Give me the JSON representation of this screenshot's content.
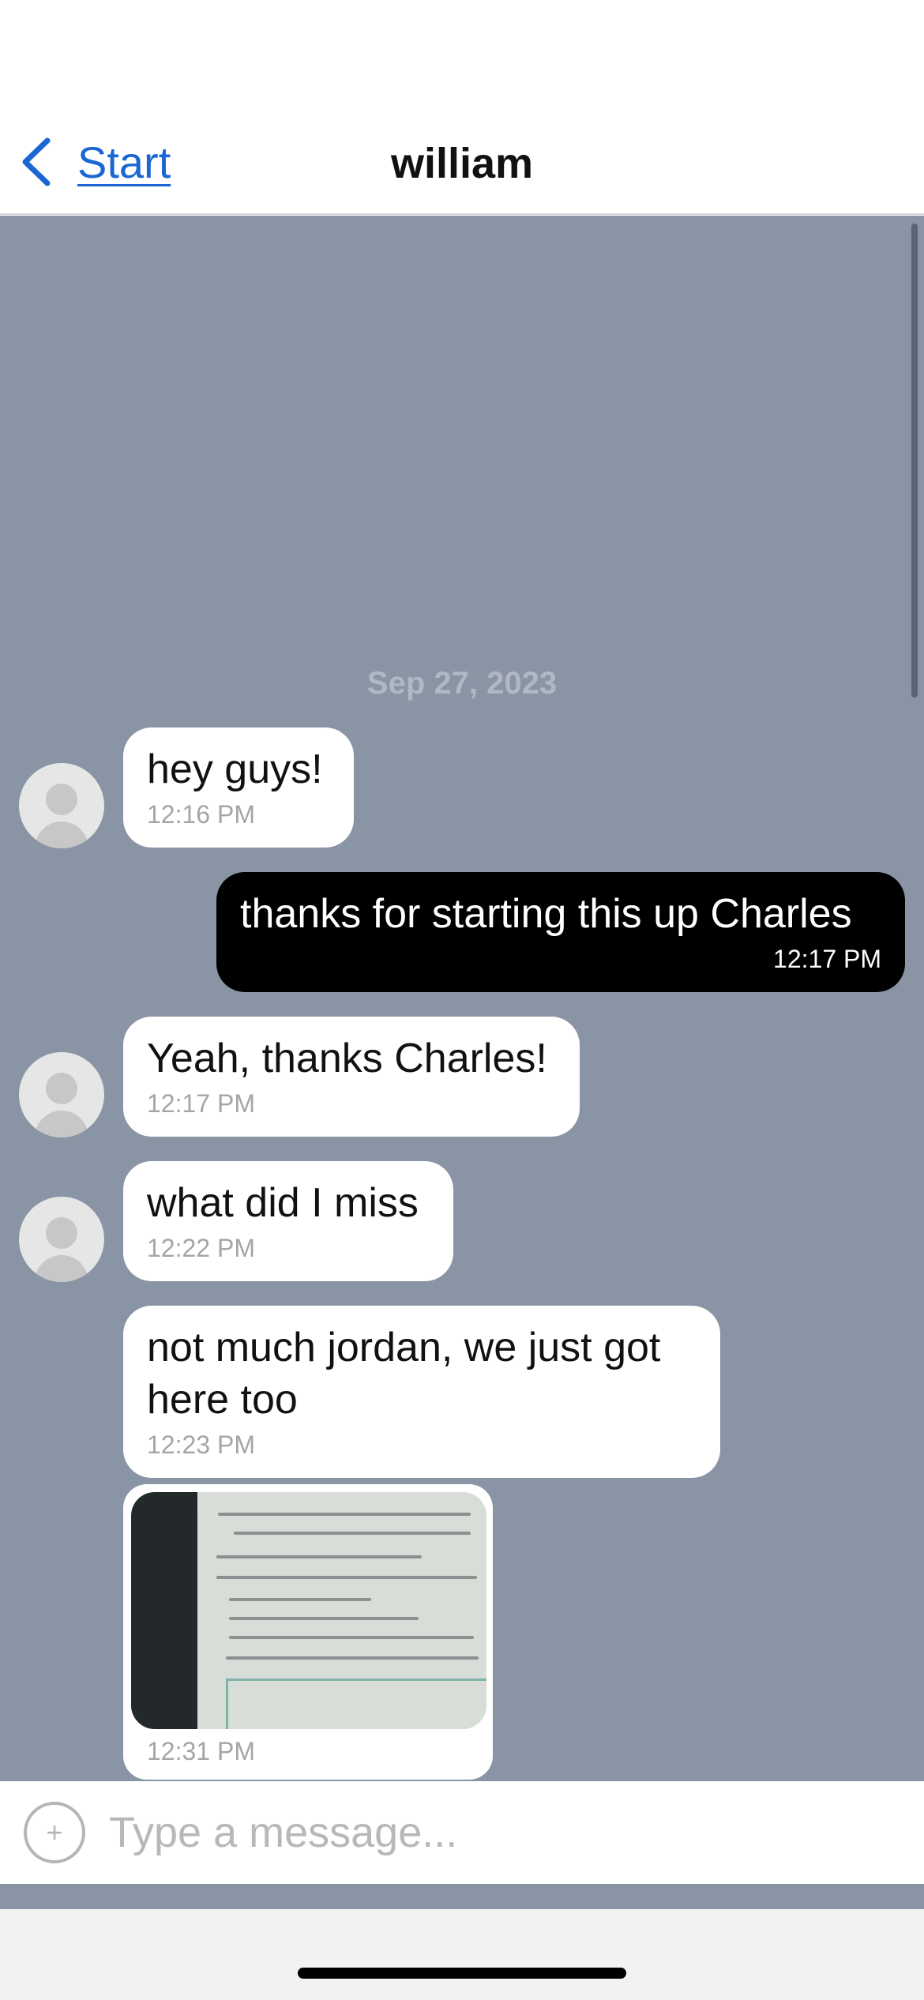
{
  "header": {
    "back_label": "Start",
    "title": "william"
  },
  "chat": {
    "background": "#8994a5",
    "date": "Sep 27, 2023",
    "messages": [
      {
        "text": "hey guys!",
        "time": "12:16 PM",
        "from": "other"
      },
      {
        "text": "thanks for starting this up Charles",
        "time": "12:17 PM",
        "from": "me"
      },
      {
        "text": "Yeah, thanks Charles!",
        "time": "12:17 PM",
        "from": "other"
      },
      {
        "text": "what did I miss",
        "time": "12:22 PM",
        "from": "other"
      },
      {
        "text": "not much jordan, we just got\nhere too",
        "time": "12:23 PM",
        "from": "other"
      },
      {
        "image": "photo-of-printed-document",
        "time": "12:31 PM",
        "from": "other"
      }
    ]
  },
  "composer": {
    "placeholder": "Type a message...",
    "value": "",
    "action_icon": "plus-icon"
  },
  "colors": {
    "link": "#1a66d2",
    "own_bubble": "#000000",
    "other_bubble": "#ffffff"
  }
}
